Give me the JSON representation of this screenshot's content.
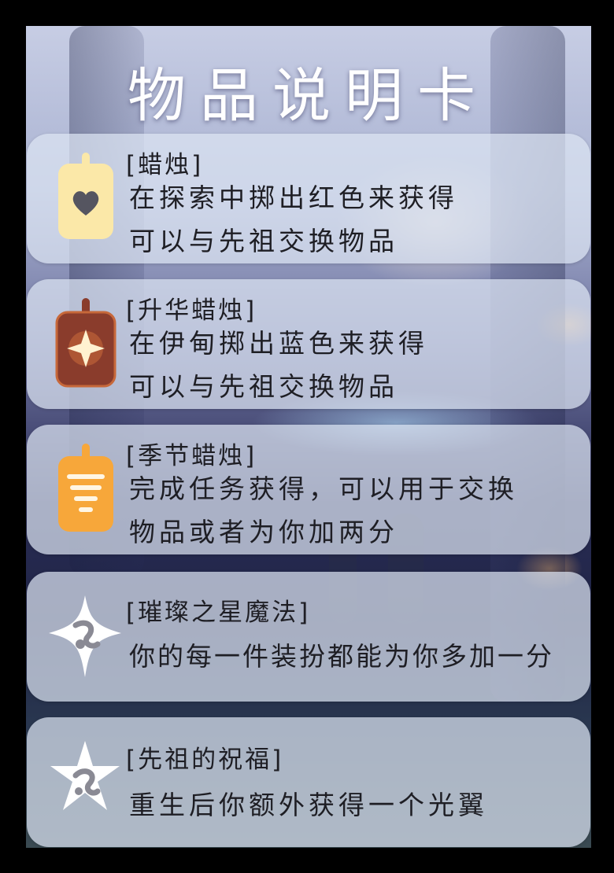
{
  "title": "物品说明卡",
  "items": [
    {
      "name": "[蜡烛]",
      "lines": [
        "在探索中掷出红色来获得",
        "可以与先祖交换物品"
      ],
      "icon": "candle-heart-icon",
      "color": "#fbe8a8"
    },
    {
      "name": "[升华蜡烛]",
      "lines": [
        "在伊甸掷出蓝色来获得",
        "可以与先祖交换物品"
      ],
      "icon": "ascended-candle-icon",
      "color": "#8a3c2c"
    },
    {
      "name": "[季节蜡烛]",
      "lines": [
        "完成任务获得，可以用于交换",
        "物品或者为你加两分"
      ],
      "icon": "seasonal-candle-icon",
      "color": "#f7a73a"
    },
    {
      "name": "[璀璨之星魔法]",
      "lines": [
        "你的每一件装扮都能为你多加一分"
      ],
      "icon": "star-magic-icon",
      "color": "#ffffff"
    },
    {
      "name": "[先祖的祝福]",
      "lines": [
        "重生后你额外获得一个光翼"
      ],
      "icon": "ancestor-blessing-icon",
      "color": "#ffffff"
    }
  ]
}
